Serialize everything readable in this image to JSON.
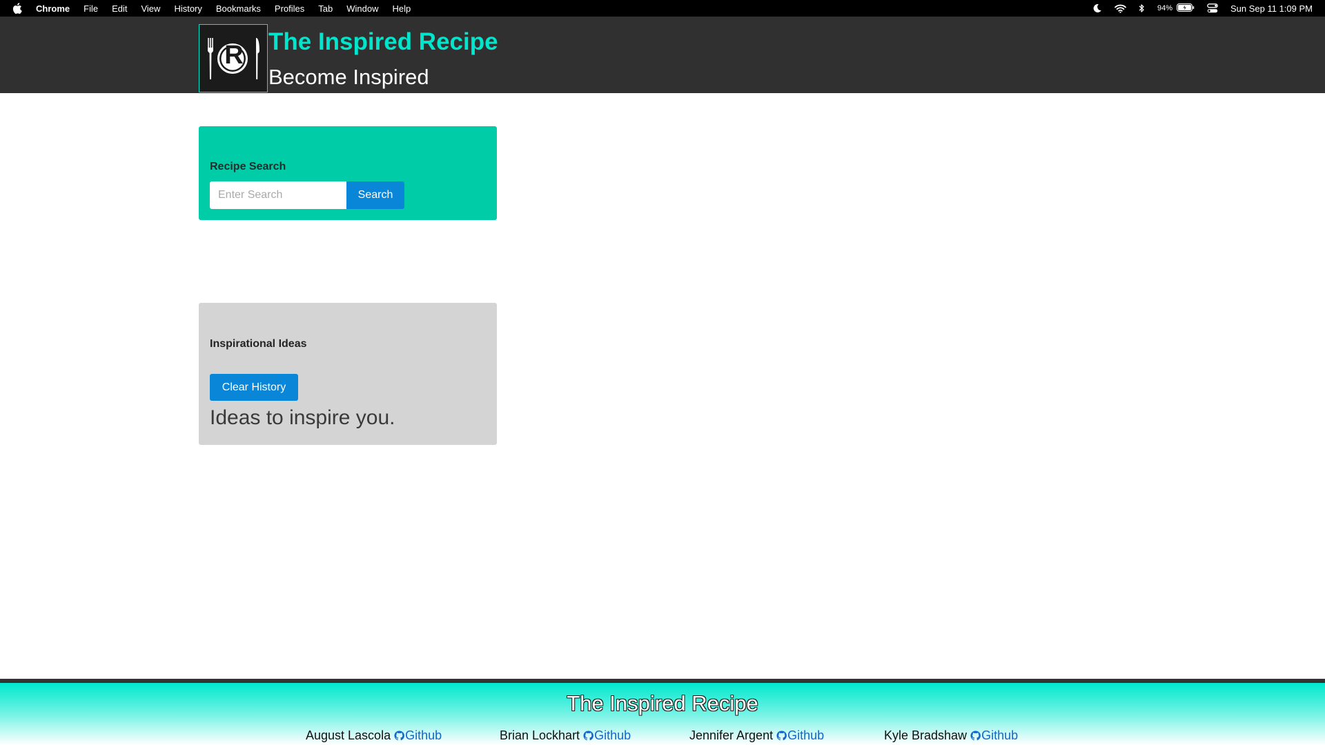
{
  "menubar": {
    "app_name": "Chrome",
    "items": [
      "File",
      "Edit",
      "View",
      "History",
      "Bookmarks",
      "Profiles",
      "Tab",
      "Window",
      "Help"
    ],
    "battery": "94%",
    "datetime": "Sun Sep 11  1:09 PM",
    "icons": [
      "apple-icon",
      "moon-icon",
      "wifi-icon",
      "bluetooth-icon",
      "battery-icon",
      "control-center-icon"
    ]
  },
  "header": {
    "logo_letter": "R",
    "title": "The Inspired Recipe",
    "subtitle": "Become Inspired"
  },
  "search": {
    "heading": "Recipe Search",
    "placeholder": "Enter Search",
    "value": "",
    "button_label": "Search"
  },
  "ideas": {
    "heading": "Inspirational Ideas",
    "clear_button_label": "Clear History",
    "text": "Ideas to inspire you."
  },
  "footer": {
    "title": "The Inspired Recipe",
    "credits": [
      {
        "name": "August Lascola",
        "link_label": "Github"
      },
      {
        "name": "Brian Lockhart",
        "link_label": "Github"
      },
      {
        "name": "Jennifer Argent",
        "link_label": "Github"
      },
      {
        "name": "Kyle Bradshaw",
        "link_label": "Github"
      }
    ]
  },
  "colors": {
    "accent_teal": "#00e5cc",
    "search_card": "#00cca8",
    "button_blue": "#0a86d8",
    "header_bg": "#303030",
    "ideas_card": "#d4d4d4",
    "link_blue": "#1466c8"
  }
}
